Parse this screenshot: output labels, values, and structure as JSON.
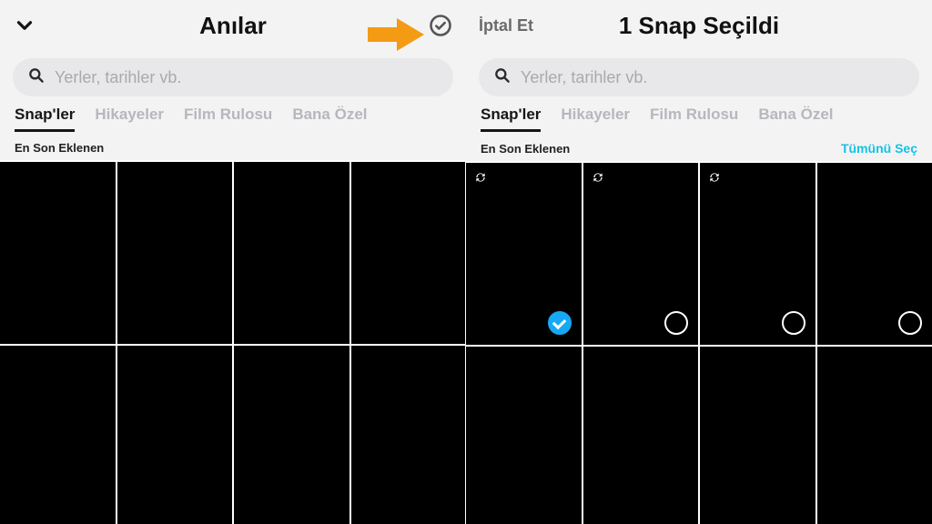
{
  "left": {
    "title": "Anılar",
    "search_placeholder": "Yerler, tarihler vb.",
    "tabs": [
      "Snap'ler",
      "Hikayeler",
      "Film Rulosu",
      "Bana Özel"
    ],
    "active_tab": 0,
    "section_label": "En Son Eklenen",
    "grid": {
      "cols": 4,
      "rows": 2
    }
  },
  "right": {
    "cancel": "İptal Et",
    "title": "1 Snap Seçildi",
    "search_placeholder": "Yerler, tarihler vb.",
    "tabs": [
      "Snap'ler",
      "Hikayeler",
      "Film Rulosu",
      "Bana Özel"
    ],
    "active_tab": 0,
    "section_label": "En Son Eklenen",
    "select_all": "Tümünü Seç",
    "tiles_row1": [
      {
        "sync": true,
        "selected": true
      },
      {
        "sync": true,
        "selected": false
      },
      {
        "sync": true,
        "selected": false
      },
      {
        "sync": false,
        "selected": false
      }
    ],
    "grid": {
      "cols": 4,
      "rows": 2
    }
  },
  "colors": {
    "accent": "#17c1e6",
    "arrow": "#f39b12"
  }
}
